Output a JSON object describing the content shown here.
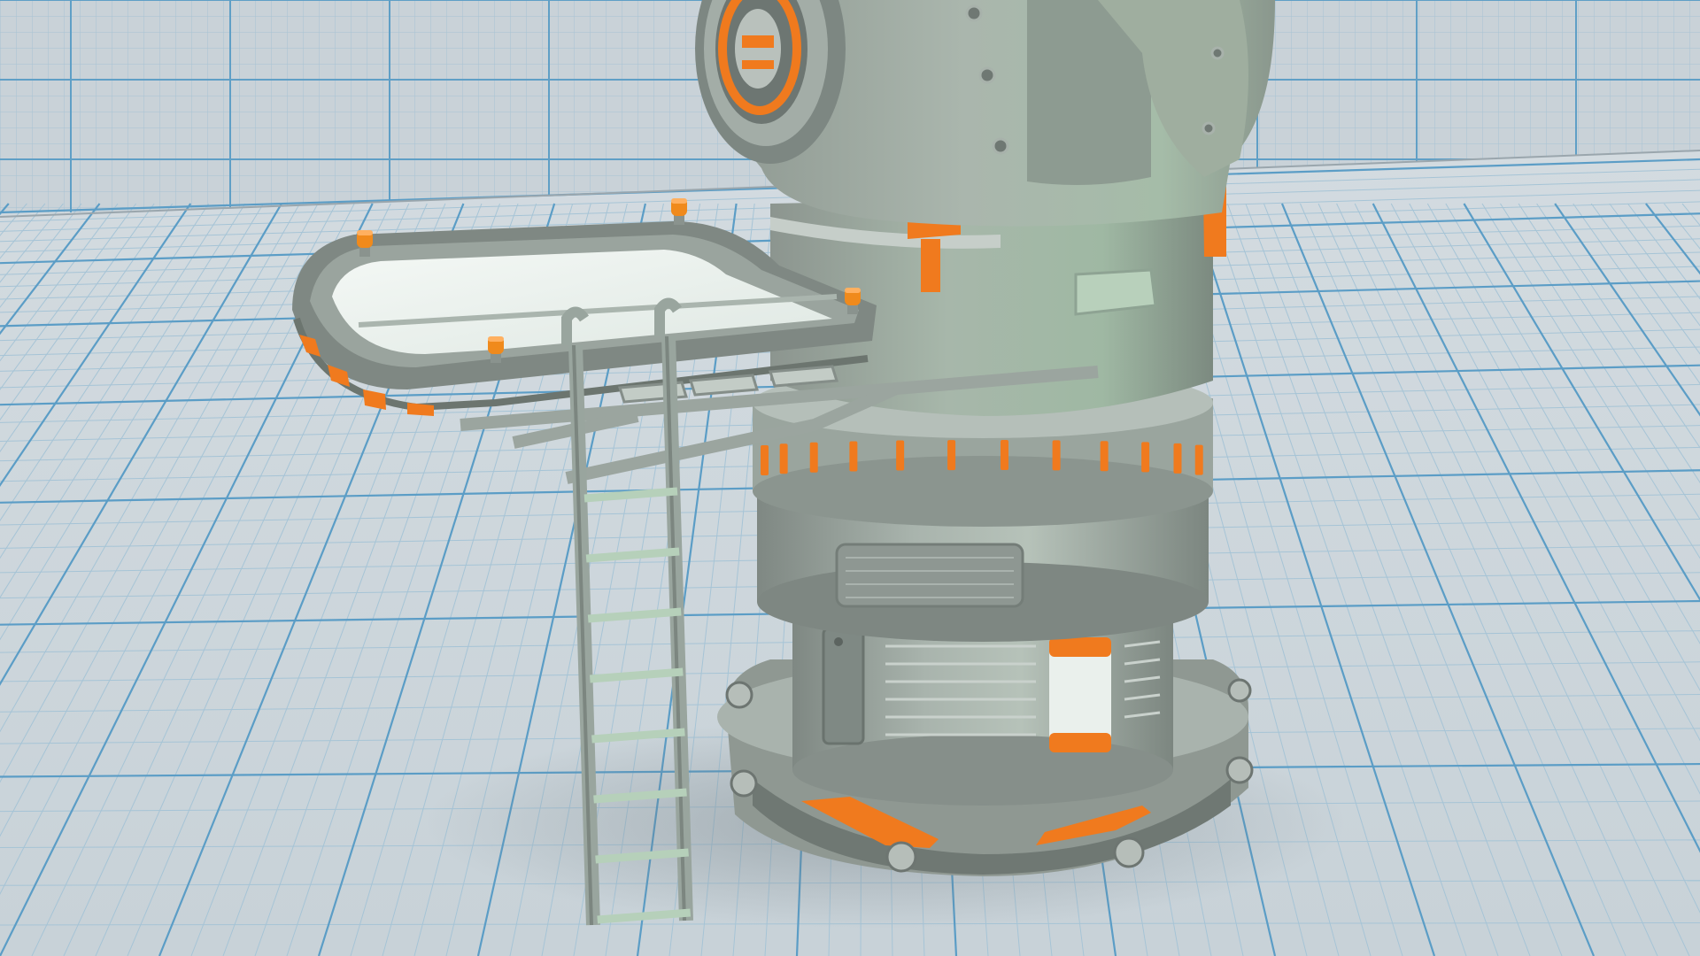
{
  "scene": {
    "subject": "sci-fi-turret-tower",
    "parts": [
      "grid-backdrop",
      "grid-floor",
      "turret-head",
      "lens-port",
      "upper-column",
      "lower-column",
      "base-ring",
      "observation-platform",
      "ladder",
      "warning-lights"
    ]
  },
  "colors": {
    "backdrop": "#c9d2d8",
    "grid_line_major": "#5a9cc4",
    "grid_line_minor": "#9fc0d4",
    "floor": "#cdd6dc",
    "hull_light": "#aebdb2",
    "hull_mid": "#8f9a94",
    "hull_dark": "#6e7773",
    "hull_shadow": "#58605d",
    "accent_orange": "#f07a1e",
    "accent_orange_dark": "#c45a10",
    "platform_glass": "#eef4f1",
    "warning_light": "#f08a1c"
  }
}
